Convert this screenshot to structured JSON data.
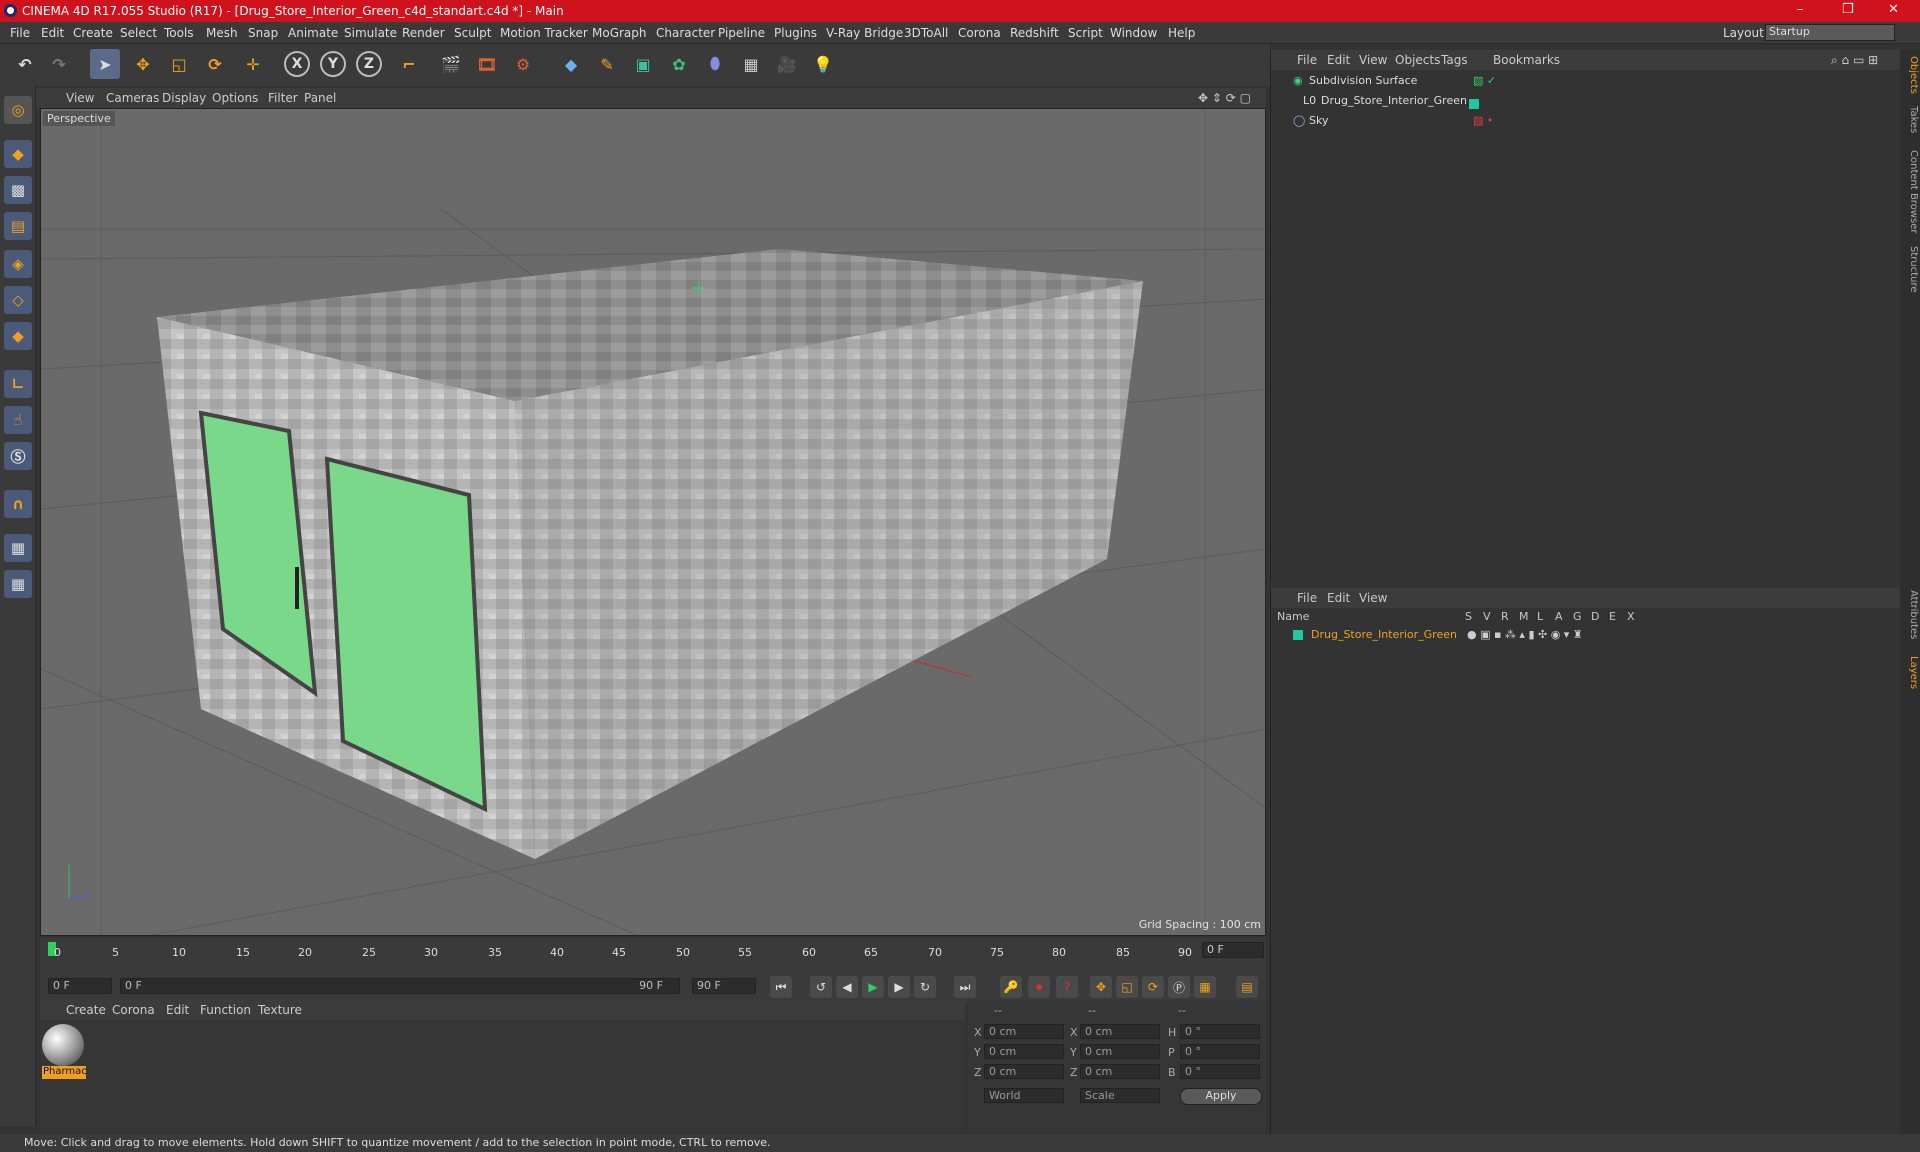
{
  "window": {
    "title": "CINEMA 4D R17.055 Studio (R17) - [Drug_Store_Interior_Green_c4d_standart.c4d *] - Main",
    "minimize": "–",
    "restore": "❐",
    "close": "✕"
  },
  "menu": [
    "File",
    "Edit",
    "Create",
    "Select",
    "Tools",
    "Mesh",
    "Snap",
    "Animate",
    "Simulate",
    "Render",
    "Sculpt",
    "Motion Tracker",
    "MoGraph",
    "Character",
    "Pipeline",
    "Plugins",
    "V-Ray Bridge",
    "3DToAll",
    "Corona",
    "Redshift",
    "Script",
    "Window",
    "Help"
  ],
  "layout": {
    "label": "Layout:",
    "value": "Startup"
  },
  "viewport": {
    "menu": [
      "View",
      "Cameras",
      "Display",
      "Options",
      "Filter",
      "Panel"
    ],
    "label": "Perspective",
    "grid_spacing": "Grid Spacing : 100 cm"
  },
  "timeline": {
    "ticks": [
      "0",
      "5",
      "10",
      "15",
      "20",
      "25",
      "30",
      "35",
      "40",
      "45",
      "50",
      "55",
      "60",
      "65",
      "70",
      "75",
      "80",
      "85",
      "90"
    ],
    "current_frame": "0 F",
    "start": "0 F",
    "range_start": "0 F",
    "range_end": "90 F",
    "end": "90 F"
  },
  "material": {
    "menu": [
      "Create",
      "Corona",
      "Edit",
      "Function",
      "Texture"
    ],
    "name": "Pharmac"
  },
  "coords": {
    "headers": [
      "--",
      "--",
      "--"
    ],
    "rows": [
      {
        "a": "X",
        "v1": "0 cm",
        "b": "X",
        "v2": "0 cm",
        "c": "H",
        "v3": "0 °"
      },
      {
        "a": "Y",
        "v1": "0 cm",
        "b": "Y",
        "v2": "0 cm",
        "c": "P",
        "v3": "0 °"
      },
      {
        "a": "Z",
        "v1": "0 cm",
        "b": "Z",
        "v2": "0 cm",
        "c": "B",
        "v3": "0 °"
      }
    ],
    "world": "World",
    "scale": "Scale",
    "apply": "Apply"
  },
  "objects": {
    "menu": [
      "File",
      "Edit",
      "View",
      "Objects",
      "Tags",
      "Bookmarks"
    ],
    "items": [
      "Subdivision Surface",
      "Drug_Store_Interior_Green",
      "Sky"
    ]
  },
  "layers": {
    "menu": [
      "File",
      "Edit",
      "View"
    ],
    "header_name": "Name",
    "columns": [
      "S",
      "V",
      "R",
      "M",
      "L",
      "A",
      "G",
      "D",
      "E",
      "X"
    ],
    "items": [
      "Drug_Store_Interior_Green"
    ]
  },
  "right_tabs": [
    "Objects",
    "Takes",
    "Content Browser",
    "Structure",
    "Attributes",
    "Layers"
  ],
  "status": "Move: Click and drag to move elements. Hold down SHIFT to quantize movement / add to the selection in point mode, CTRL to remove.",
  "colors": {
    "title_bar": "#d0121c",
    "accent": "#f0a020",
    "layer_green": "#1ec8a0",
    "door_green": "#7ad88a"
  }
}
